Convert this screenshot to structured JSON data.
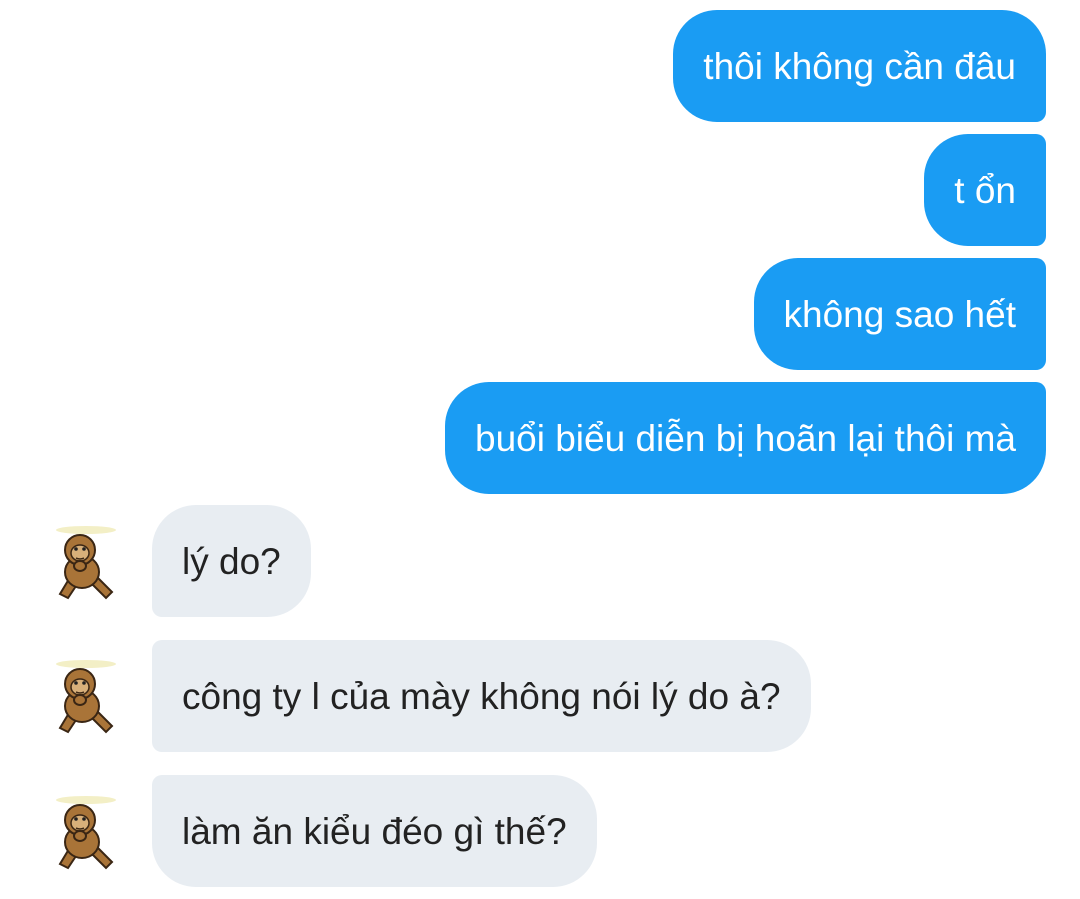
{
  "colors": {
    "outgoing_bubble": "#1a9cf3",
    "incoming_bubble": "#e8edf2",
    "outgoing_text": "#ffffff",
    "incoming_text": "#222222"
  },
  "messages": {
    "outgoing": [
      {
        "text": "thôi không cần đâu"
      },
      {
        "text": "t ổn"
      },
      {
        "text": "không sao hết"
      },
      {
        "text": "buổi biểu diễn bị hoãn lại thôi mà"
      }
    ],
    "incoming": [
      {
        "text": "lý do?",
        "avatar_icon": "monkey-avatar-icon"
      },
      {
        "text": "công ty l của mày không nói lý do à?",
        "avatar_icon": "monkey-avatar-icon"
      },
      {
        "text": "làm ăn kiểu đéo gì thế?",
        "avatar_icon": "monkey-avatar-icon"
      }
    ]
  }
}
